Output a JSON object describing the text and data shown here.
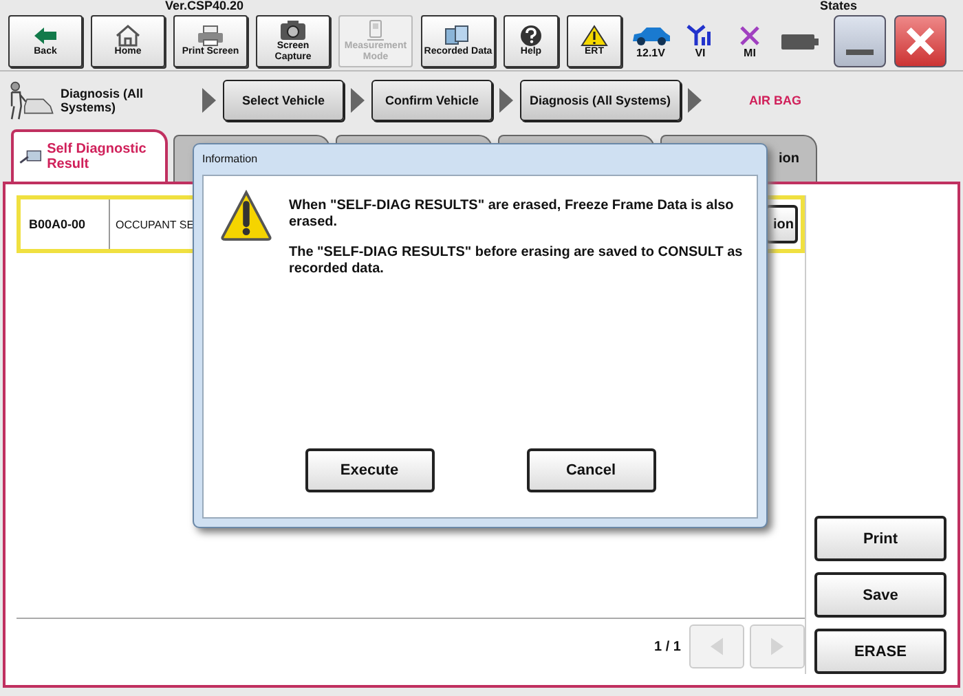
{
  "header": {
    "version": "Ver.CSP40.20",
    "states_label": "States"
  },
  "toolbar": [
    {
      "kind": "back",
      "label": "Back",
      "disabled": false
    },
    {
      "kind": "home",
      "label": "Home",
      "disabled": false
    },
    {
      "kind": "print",
      "label": "Print Screen",
      "disabled": false
    },
    {
      "kind": "camera",
      "label": "Screen Capture",
      "disabled": false
    },
    {
      "kind": "measure",
      "label": "Measurement Mode",
      "disabled": true
    },
    {
      "kind": "recorded",
      "label": "Recorded Data",
      "disabled": false
    },
    {
      "kind": "help",
      "label": "Help",
      "disabled": false
    },
    {
      "kind": "ert",
      "label": "ERT",
      "disabled": false
    }
  ],
  "status": [
    {
      "kind": "car",
      "label": "12.1V"
    },
    {
      "kind": "vi",
      "label": "VI"
    },
    {
      "kind": "mi",
      "label": "MI"
    },
    {
      "kind": "battery"
    }
  ],
  "breadcrumb": {
    "current": "Diagnosis (All Systems)",
    "steps": [
      "Select Vehicle",
      "Confirm Vehicle",
      "Diagnosis (All Systems)"
    ],
    "system": "AIR BAG"
  },
  "tabs": [
    {
      "label": "Self Diagnostic Result",
      "selected": true
    },
    {
      "selected": false
    },
    {
      "selected": false
    },
    {
      "selected": false
    },
    {
      "label": "ion",
      "selected": false
    }
  ],
  "results": [
    {
      "code": "B00A0-00",
      "description": "OCCUPANT SE",
      "action": "ion"
    }
  ],
  "pager": {
    "text": "1 / 1",
    "prev_disabled": true,
    "next_disabled": true
  },
  "side_buttons": [
    "Print",
    "Save",
    "ERASE"
  ],
  "dialog": {
    "title": "Information",
    "paragraphs": [
      "When \"SELF-DIAG RESULTS\" are erased, Freeze Frame Data is also erased.",
      "The \"SELF-DIAG RESULTS\" before erasing are saved to CONSULT as recorded data."
    ],
    "buttons": [
      "Execute",
      "Cancel"
    ]
  }
}
